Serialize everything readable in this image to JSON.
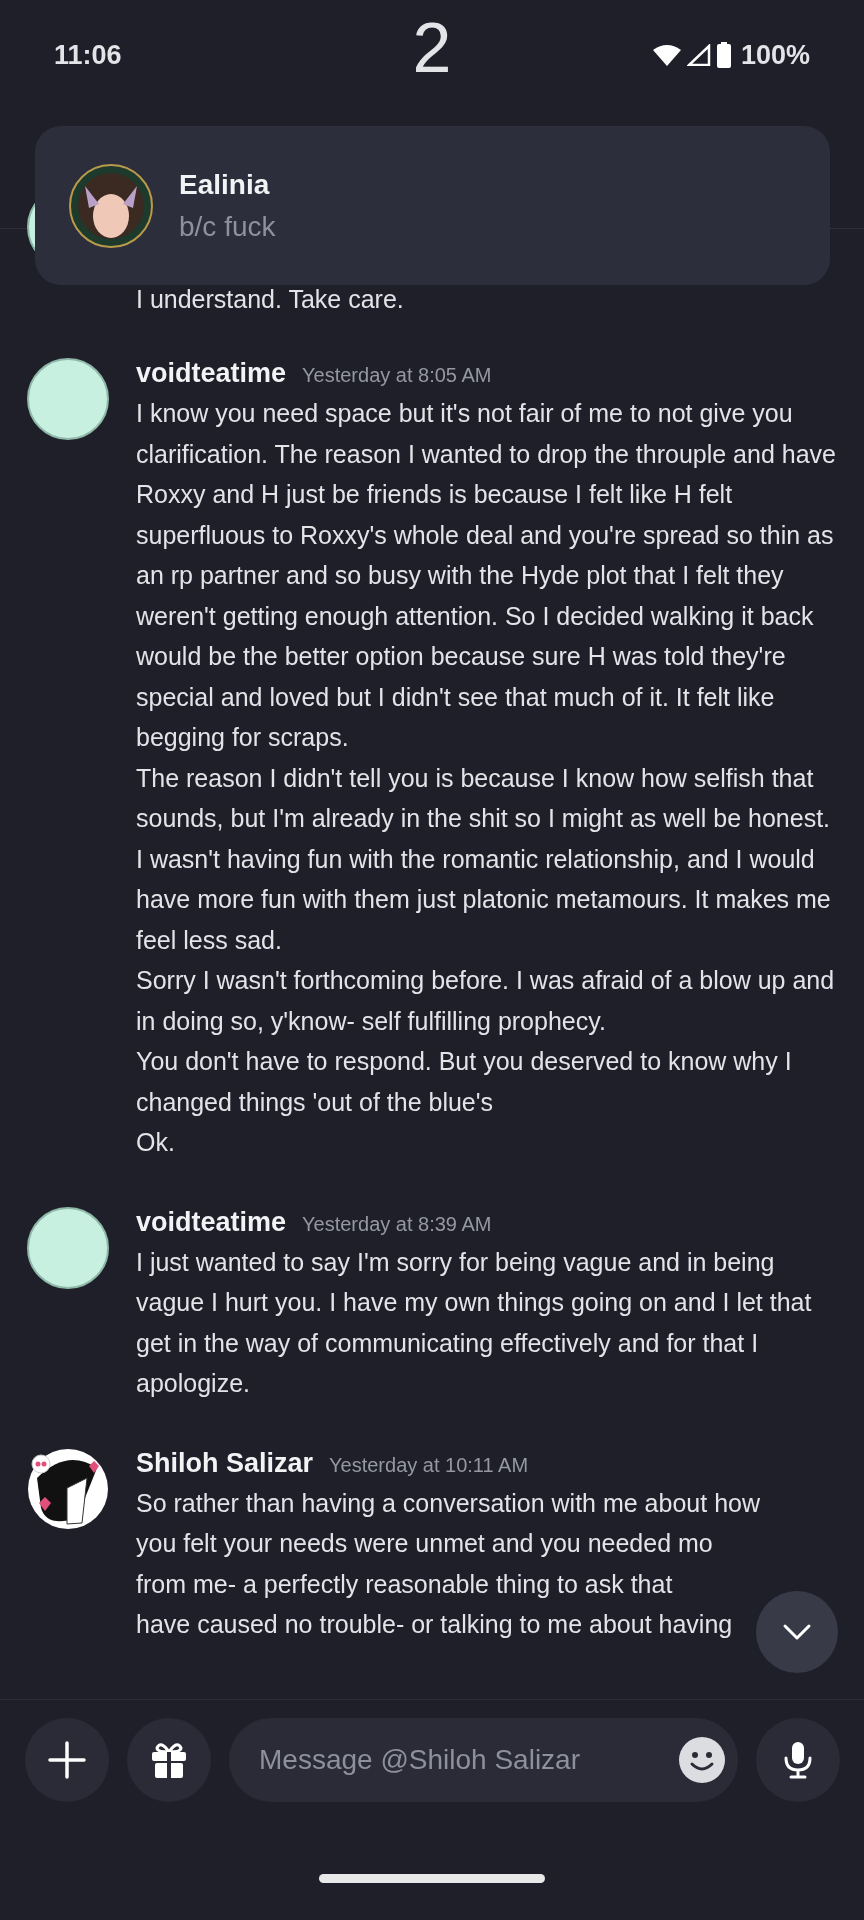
{
  "status_bar": {
    "time": "11:06",
    "center": "2",
    "battery": "100%"
  },
  "notification": {
    "sender": "Ealinia",
    "text": "b/c fuck"
  },
  "messages": [
    {
      "kind": "tail",
      "avatar": {
        "kind": "mint"
      },
      "paragraphs": [
        "I understand. Take care."
      ]
    },
    {
      "kind": "full",
      "avatar": {
        "kind": "mint"
      },
      "author": "voidteatime",
      "time": "Yesterday at 8:05 AM",
      "paragraphs": [
        "I know you need space but it's not fair of me to not give you clarification. The reason I wanted to drop the throuple and have Roxxy and H just be friends is because I felt like H felt superfluous to Roxxy's whole deal and you're spread so thin as an rp partner and so busy with the Hyde plot that I felt they weren't getting enough attention. So I decided walking it back would be the better option because sure H was told they're special and loved but I didn't see that much of it. It felt like begging for scraps.",
        "The reason I didn't tell you is because I know how selfish that sounds, but I'm already in the shit so I might as well be honest.",
        "I wasn't having fun with the romantic relationship, and I would have more fun with them just platonic metamours. It makes me feel less sad.",
        "Sorry I wasn't forthcoming before. I was afraid of a blow up and in doing so, y'know- self fulfilling prophecy.",
        "You don't have to respond. But you deserved to know why I changed things 'out of the blue's",
        "Ok."
      ]
    },
    {
      "kind": "full",
      "avatar": {
        "kind": "mint"
      },
      "author": "voidteatime",
      "time": "Yesterday at 8:39 AM",
      "paragraphs": [
        "I just wanted to say I'm sorry for being vague and in being vague I hurt you. I have my own things going on and I let that get in the way of communicating effectively and for that I apologize."
      ]
    },
    {
      "kind": "lines",
      "avatar": {
        "kind": "hearts"
      },
      "author": "Shiloh Salizar",
      "time": "Yesterday at 10:11 AM",
      "paragraphs": [
        "So rather than having a conversation with me about how",
        "you felt your needs were unmet and you needed mo",
        "from me- a perfectly reasonable thing to ask that",
        "have caused no trouble- or talking to me about having"
      ]
    }
  ],
  "composer": {
    "placeholder": "Message @Shiloh Salizar"
  }
}
